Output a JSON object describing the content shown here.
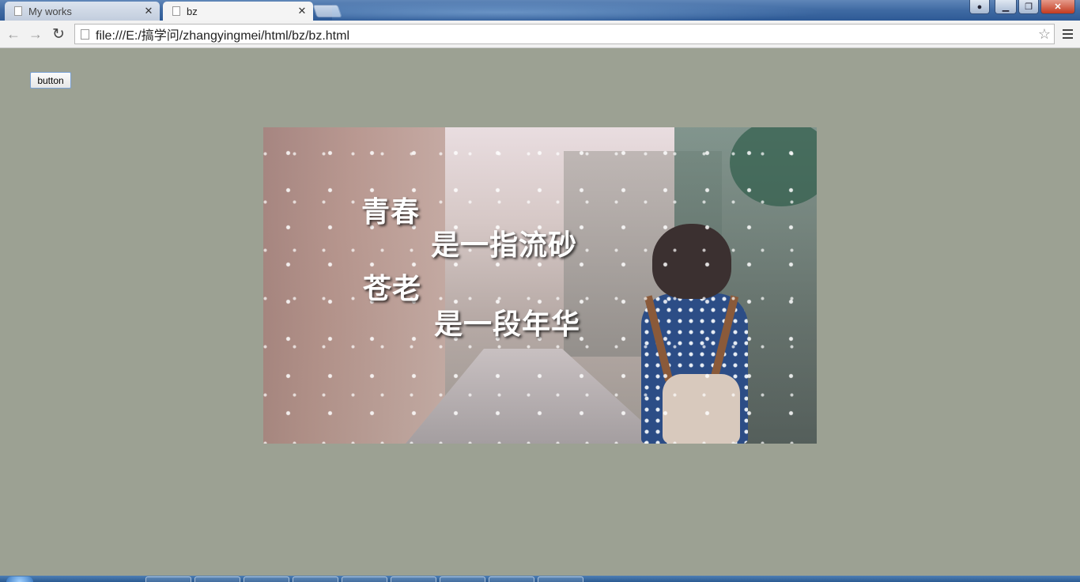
{
  "browser": {
    "tabs": [
      {
        "title": "My works",
        "active": false
      },
      {
        "title": "bz",
        "active": true
      }
    ],
    "url": "file:///E:/搞学问/zhangyingmei/html/bz/bz.html"
  },
  "page": {
    "button_label": "button",
    "image": {
      "poem_lines": [
        "青春",
        "是一指流砂",
        "苍老",
        "是一段年华"
      ]
    },
    "background_color": "#9ca193"
  },
  "icons": {
    "back": "back-arrow-icon",
    "forward": "forward-arrow-icon",
    "reload": "reload-icon",
    "bookmark": "star-icon",
    "menu": "menu-icon"
  }
}
